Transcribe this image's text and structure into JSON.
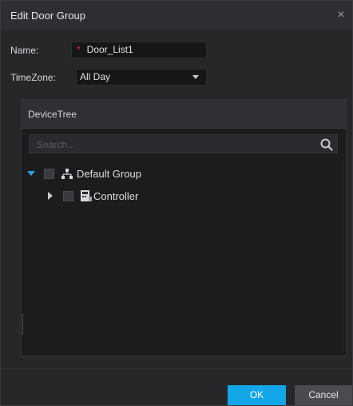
{
  "dialog": {
    "title": "Edit Door Group",
    "close_glyph": "×"
  },
  "form": {
    "name_label": "Name:",
    "name_required": "*",
    "name_value": "Door_List1",
    "timezone_label": "TimeZone:",
    "timezone_value": "All Day"
  },
  "tree": {
    "header": "DeviceTree",
    "search_placeholder": "Search...",
    "nodes": [
      {
        "label": "Default Group",
        "icon": "group-icon",
        "expanded": true,
        "checked": false
      },
      {
        "label": "Controller",
        "icon": "controller-icon",
        "expanded": false,
        "checked": false
      }
    ]
  },
  "buttons": {
    "ok": "OK",
    "cancel": "Cancel"
  },
  "colors": {
    "accent": "#12a6e8",
    "required": "#e0333a",
    "background": "#262729"
  }
}
